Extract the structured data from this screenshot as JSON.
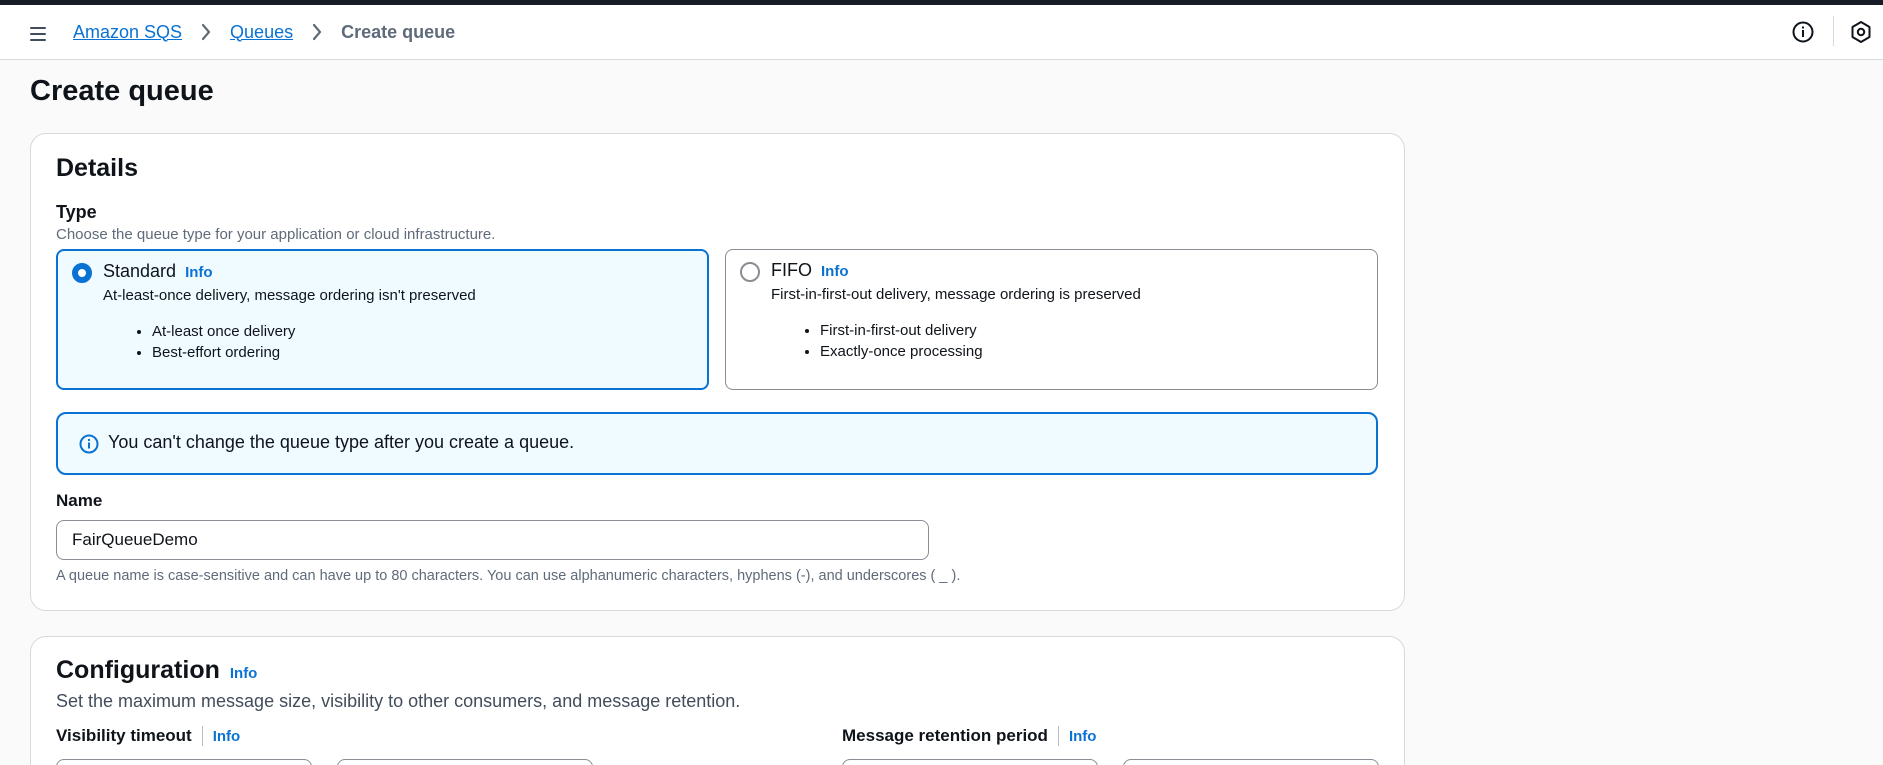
{
  "breadcrumb": {
    "items": [
      "Amazon SQS",
      "Queues"
    ],
    "current": "Create queue"
  },
  "page": {
    "title": "Create queue"
  },
  "details": {
    "title": "Details",
    "type_label": "Type",
    "type_description": "Choose the queue type for your application or cloud infrastructure.",
    "options": [
      {
        "title": "Standard",
        "info": "Info",
        "description": "At-least-once delivery, message ordering isn't preserved",
        "bullets": [
          "At-least once delivery",
          "Best-effort ordering"
        ],
        "selected": true
      },
      {
        "title": "FIFO",
        "info": "Info",
        "description": "First-in-first-out delivery, message ordering is preserved",
        "bullets": [
          "First-in-first-out delivery",
          "Exactly-once processing"
        ],
        "selected": false
      }
    ],
    "alert": "You can't change the queue type after you create a queue.",
    "name_label": "Name",
    "name_value": "FairQueueDemo",
    "name_hint": "A queue name is case-sensitive and can have up to 80 characters. You can use alphanumeric characters, hyphens (-), and underscores ( _ )."
  },
  "configuration": {
    "title": "Configuration",
    "info": "Info",
    "description": "Set the maximum message size, visibility to other consumers, and message retention.",
    "visibility_label": "Visibility timeout",
    "visibility_info": "Info",
    "retention_label": "Message retention period",
    "retention_info": "Info"
  },
  "colors": {
    "accent": "#0972d3",
    "selected_bg": "#f0fbff",
    "header_strip": "#161d26"
  },
  "icons": {
    "menu": "hamburger-menu-icon",
    "crumb_separator": "chevron-right-icon",
    "help": "info-circle-icon",
    "settings": "hexagon-settings-icon",
    "alert": "info-circle-icon"
  }
}
